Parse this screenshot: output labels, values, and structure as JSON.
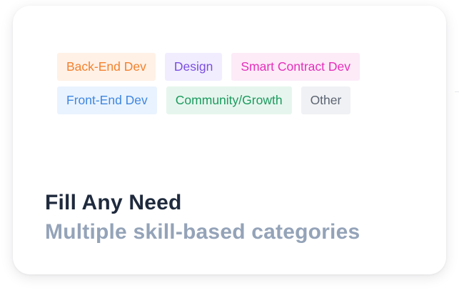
{
  "tags": {
    "row1": [
      {
        "label": "Back-End Dev",
        "bg": "#fff1e6",
        "fg": "#f2822f"
      },
      {
        "label": "Design",
        "bg": "#f1edff",
        "fg": "#7b4fe0"
      },
      {
        "label": "Smart Contract Dev",
        "bg": "#fdebf8",
        "fg": "#e52fba"
      }
    ],
    "row2": [
      {
        "label": "Front-End Dev",
        "bg": "#e9f3ff",
        "fg": "#3f86e0"
      },
      {
        "label": "Community/Growth",
        "bg": "#e6f6ee",
        "fg": "#1c9a5e"
      },
      {
        "label": "Other",
        "bg": "#f0f1f4",
        "fg": "#5b6472"
      }
    ]
  },
  "heading": "Fill Any Need",
  "subheading": "Multiple skill-based categories"
}
